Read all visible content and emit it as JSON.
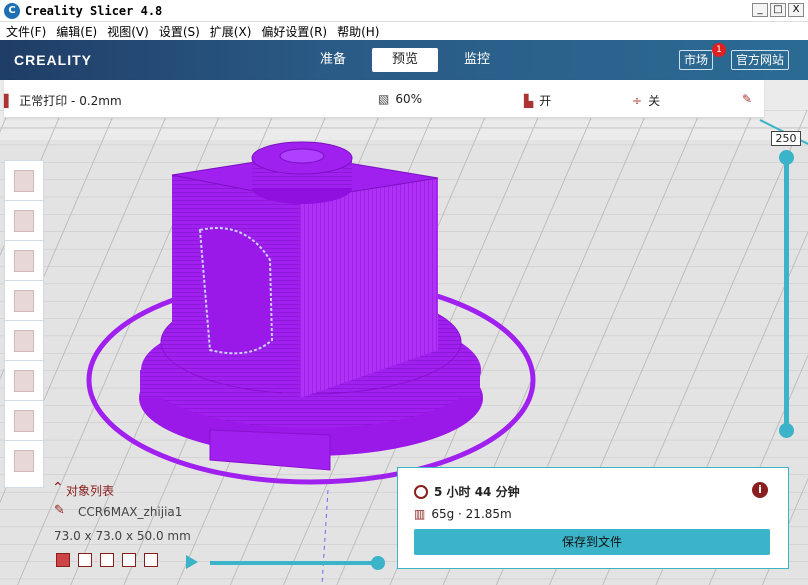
{
  "window": {
    "title": "Creality Slicer 4.8",
    "app_icon": "C",
    "controls": [
      "_",
      "□",
      "X"
    ]
  },
  "menu": [
    "文件(F)",
    "编辑(E)",
    "视图(V)",
    "设置(S)",
    "扩展(X)",
    "偏好设置(R)",
    "帮助(H)"
  ],
  "header": {
    "logo": "CREALITY",
    "tabs": [
      {
        "label": "准备",
        "active": false
      },
      {
        "label": "预览",
        "active": true
      },
      {
        "label": "监控",
        "active": false
      }
    ],
    "market_label": "市场",
    "market_badge": "1",
    "website_label": "官方网站"
  },
  "settings": {
    "profile": "正常打印 - 0.2mm",
    "infill": "60%",
    "support": "开",
    "adhesion": "关"
  },
  "layer_slider": {
    "top_value": "250"
  },
  "objects": {
    "heading": "对象列表",
    "name": "CCR6MAX_zhijia1",
    "dimensions": "73.0 x 73.0 x 50.0 mm"
  },
  "print_info": {
    "time": "5 小时 44 分钟",
    "material": "65g · 21.85m",
    "save_label": "保存到文件"
  },
  "colors": {
    "accent": "#3bb3c8",
    "model": "#a020f0",
    "brand_dark": "#8a1d1d"
  },
  "icons": [
    "clock-icon",
    "spool-icon",
    "info-icon",
    "edit-icon",
    "play-icon",
    "infill-icon",
    "support-icon",
    "adhesion-icon"
  ]
}
